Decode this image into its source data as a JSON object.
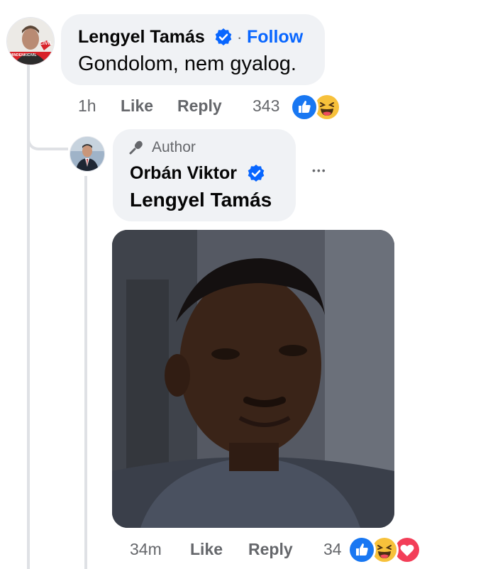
{
  "comment": {
    "author": "Lengyel Tamás",
    "follow_label": "Follow",
    "separator": "·",
    "text": "Gondolom, nem gyalog.",
    "time": "1h",
    "like_label": "Like",
    "reply_label": "Reply",
    "reaction_count": "343",
    "reactions": [
      "like-icon",
      "haha-icon"
    ],
    "avatar_badge": "CIVIL",
    "avatar_caption": "MINDENKICIVIL"
  },
  "reply": {
    "author_badge": "Author",
    "author": "Orbán Viktor",
    "text": "Lengyel Tamás",
    "more_label": "•••",
    "time": "34m",
    "like_label": "Like",
    "reply_label": "Reply",
    "reaction_count": "34",
    "reactions": [
      "like-icon",
      "haha-icon",
      "love-icon"
    ]
  },
  "colors": {
    "link_blue": "#0866ff",
    "bubble_bg": "#f0f2f5",
    "meta_gray": "#65676b",
    "thread_line": "#dfe1e5"
  }
}
